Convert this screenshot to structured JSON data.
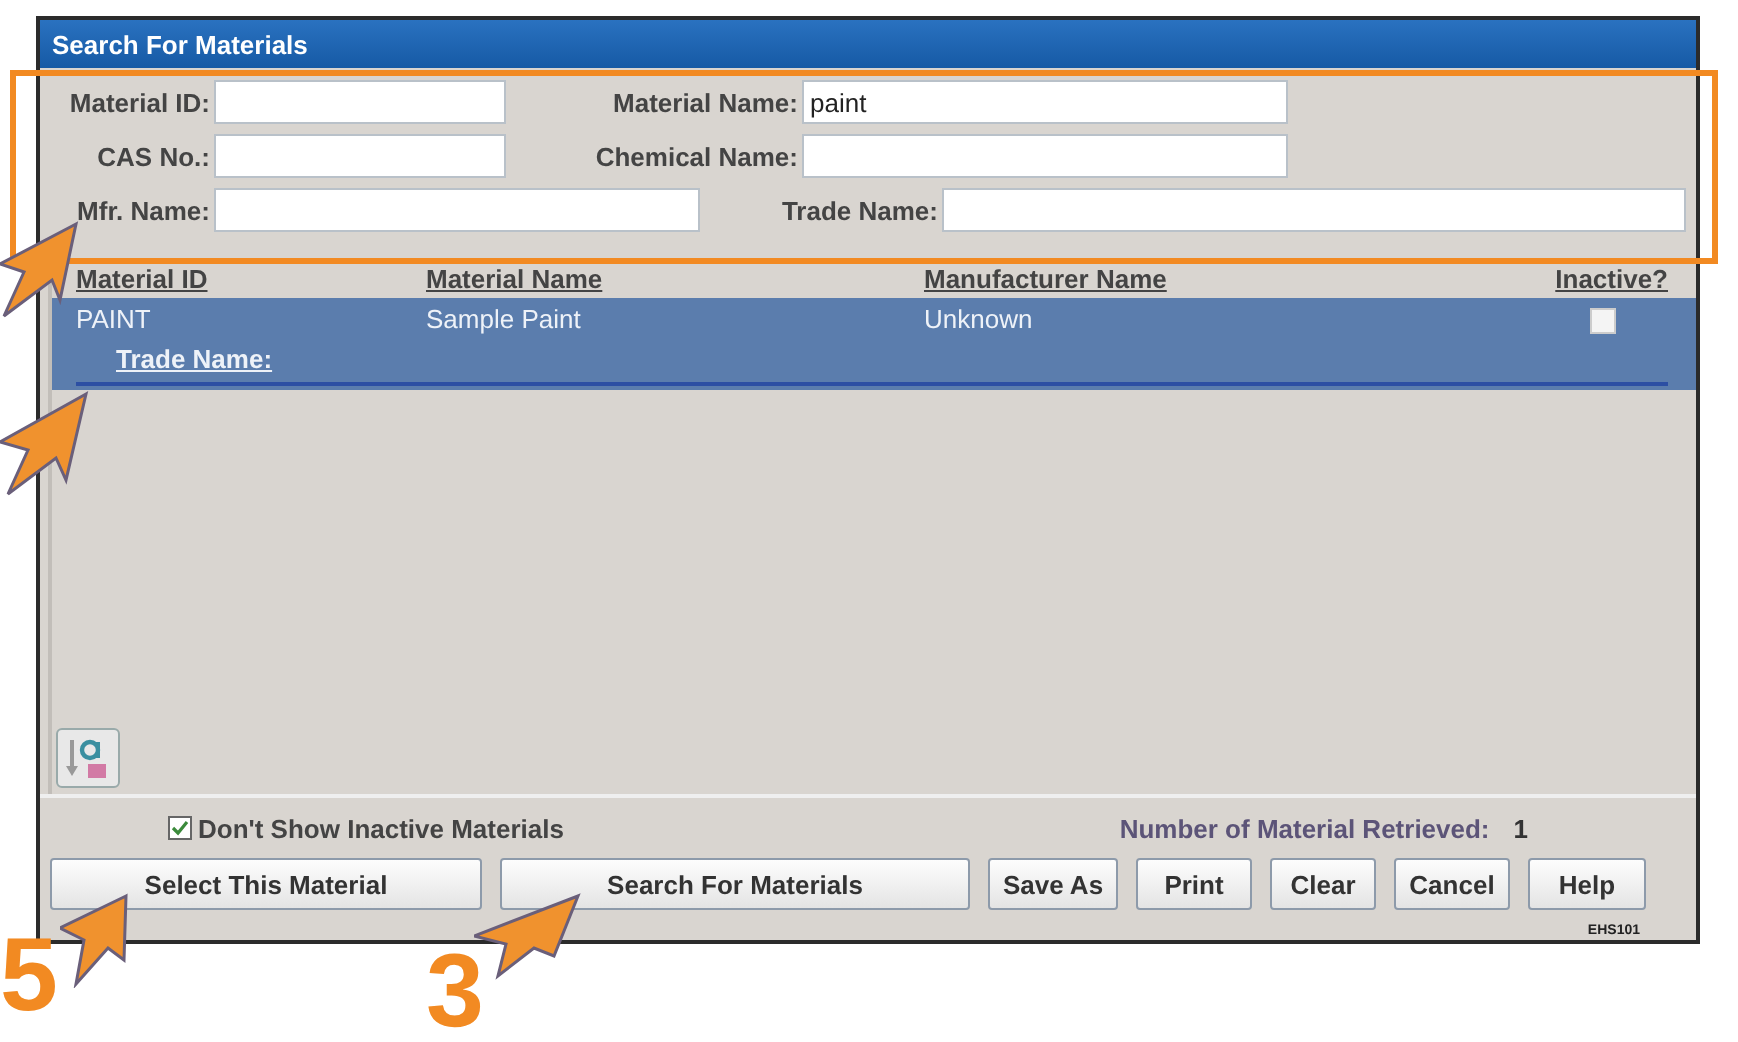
{
  "window": {
    "title": "Search For Materials"
  },
  "search_rows": [
    {
      "fields": [
        {
          "label": "Material ID:"
        },
        {
          "label": "Material Name:",
          "value": "paint"
        }
      ]
    },
    {
      "fields": [
        {
          "label": "CAS No.:"
        },
        {
          "label": "Chemical Name:"
        }
      ]
    },
    {
      "fields": [
        {
          "label": "Mfr. Name:"
        },
        {
          "label": "Trade Name:"
        }
      ]
    }
  ],
  "table": {
    "columns": [
      "Material ID",
      "Material Name",
      "Manufacturer Name",
      "Inactive?"
    ],
    "rows": [
      {
        "cells": [
          "PAINT",
          "Sample Paint",
          "Unknown"
        ],
        "inactive": false,
        "selected": true,
        "sub_label": "Trade Name:"
      }
    ]
  },
  "hide_inactive": {
    "label": "Don't Show Inactive Materials",
    "checked": true
  },
  "retrieved": {
    "label": "Number of Material Retrieved:",
    "count": "1"
  },
  "buttons": [
    {
      "label": "Select This Material"
    },
    {
      "label": "Search For Materials"
    },
    {
      "label": "Save As"
    },
    {
      "label": "Print"
    },
    {
      "label": "Clear"
    },
    {
      "label": "Cancel"
    },
    {
      "label": "Help"
    }
  ],
  "form_code": "EHS101",
  "callouts": [
    {
      "number": "5"
    },
    {
      "number": "3"
    }
  ]
}
